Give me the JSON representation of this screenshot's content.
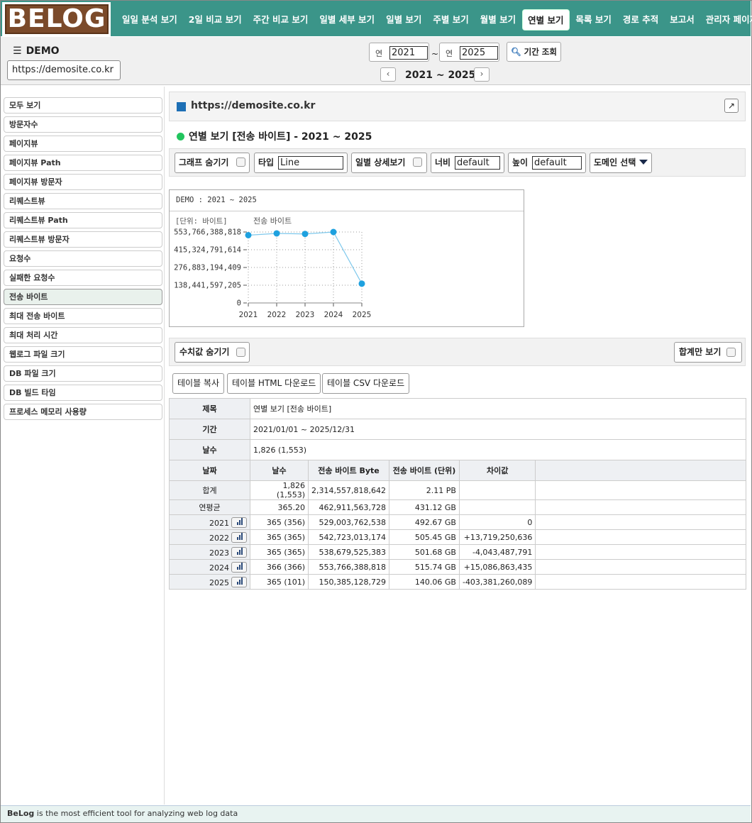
{
  "brand": {
    "logo_text": "BELOG"
  },
  "nav": [
    {
      "label": "일일 분석 보기"
    },
    {
      "label": "2일 비교 보기"
    },
    {
      "label": "주간 비교 보기"
    },
    {
      "label": "일별 세부 보기"
    },
    {
      "label": "일별 보기"
    },
    {
      "label": "주별 보기"
    },
    {
      "label": "월별 보기"
    },
    {
      "label": "연별 보기",
      "active": true
    },
    {
      "label": "목록 보기"
    },
    {
      "label": "경로 추적"
    },
    {
      "label": "보고서"
    },
    {
      "label": "관리자 페이지"
    }
  ],
  "site": {
    "name": "DEMO",
    "url": "https://demosite.co.kr"
  },
  "period": {
    "from_label": "연",
    "from_value": "2021",
    "to_label": "연",
    "to_value": "2025",
    "tilde": "~",
    "search_label": "기간 조회",
    "range_title": "2021 ~ 2025",
    "prev": "‹",
    "next": "›"
  },
  "sidebar": [
    {
      "label": "모두 보기"
    },
    {
      "label": "방문자수"
    },
    {
      "label": "페이지뷰"
    },
    {
      "label": "페이지뷰 Path"
    },
    {
      "label": "페이지뷰 방문자"
    },
    {
      "label": "리퀘스트뷰"
    },
    {
      "label": "리퀘스트뷰 Path"
    },
    {
      "label": "리퀘스트뷰 방문자"
    },
    {
      "label": "요청수"
    },
    {
      "label": "실패한 요청수"
    },
    {
      "label": "전송 바이트",
      "active": true
    },
    {
      "label": "최대 전송 바이트"
    },
    {
      "label": "최대 처리 시간"
    },
    {
      "label": "웹로그 파일 크기"
    },
    {
      "label": "DB 파일 크기"
    },
    {
      "label": "DB 빌드 타임"
    },
    {
      "label": "프로세스 메모리 사용량"
    }
  ],
  "card": {
    "url": "https://demosite.co.kr",
    "ext_icon": "↗"
  },
  "section_title": "연별 보기 [전송 바이트] - 2021 ~ 2025",
  "options": {
    "hide_graph": "그래프 숨기기",
    "type_label": "타입",
    "type_value": "Line",
    "daily_detail": "일별 상세보기",
    "width_label": "너비",
    "width_value": "default",
    "height_label": "높이",
    "height_value": "default",
    "domain_select": "도메인 선택"
  },
  "chart_data": {
    "type": "line",
    "title": "DEMO : 2021 ~ 2025",
    "unit_label": "[단위: 바이트]",
    "series": [
      {
        "name": "전송 바이트",
        "values": [
          529003762538,
          542723013174,
          538679525383,
          553766388818,
          150385128729
        ]
      }
    ],
    "categories": [
      "2021",
      "2022",
      "2023",
      "2024",
      "2025"
    ],
    "y_ticks": [
      {
        "value": 553766388818,
        "label": "553,766,388,818"
      },
      {
        "value": 415324791614,
        "label": "415,324,791,614"
      },
      {
        "value": 276883194409,
        "label": "276,883,194,409"
      },
      {
        "value": 138441597205,
        "label": "138,441,597,205"
      },
      {
        "value": 0,
        "label": "0"
      }
    ],
    "ylim": [
      0,
      553766388818
    ],
    "grid": true,
    "colors": {
      "line": "#7dc8ec",
      "point": "#1ea1df"
    }
  },
  "value_options": {
    "hide_values": "수치값 숨기기",
    "total_only": "합계만 보기"
  },
  "table_actions": {
    "copy": "테이블 복사",
    "html": "테이블 HTML 다운로드",
    "csv": "테이블 CSV 다운로드"
  },
  "table": {
    "meta": [
      {
        "key": "제목",
        "value": "연별 보기 [전송 바이트]"
      },
      {
        "key": "기간",
        "value": "2021/01/01 ~ 2025/12/31"
      },
      {
        "key": "날수",
        "value": "1,826 (1,553)"
      }
    ],
    "headers": [
      "날짜",
      "날수",
      "전송 바이트 Byte",
      "전송 바이트 (단위)",
      "차이값"
    ],
    "rows": [
      {
        "date": "합계",
        "days": "1,826 (1,553)",
        "bytes": "2,314,557,818,642",
        "unit": "2.11 PB",
        "diff": "",
        "chart": false
      },
      {
        "date": "연평균",
        "days": "365.20",
        "bytes": "462,911,563,728",
        "unit": "431.12 GB",
        "diff": "",
        "chart": false
      },
      {
        "date": "2021",
        "days": "365 (356)",
        "bytes": "529,003,762,538",
        "unit": "492.67 GB",
        "diff": "0",
        "chart": true
      },
      {
        "date": "2022",
        "days": "365 (365)",
        "bytes": "542,723,013,174",
        "unit": "505.45 GB",
        "diff": "+13,719,250,636",
        "chart": true
      },
      {
        "date": "2023",
        "days": "365 (365)",
        "bytes": "538,679,525,383",
        "unit": "501.68 GB",
        "diff": "-4,043,487,791",
        "chart": true
      },
      {
        "date": "2024",
        "days": "366 (366)",
        "bytes": "553,766,388,818",
        "unit": "515.74 GB",
        "diff": "+15,086,863,435",
        "chart": true
      },
      {
        "date": "2025",
        "days": "365 (101)",
        "bytes": "150,385,128,729",
        "unit": "140.06 GB",
        "diff": "-403,381,260,089",
        "chart": true
      }
    ]
  },
  "footer": {
    "brand": "BeLog",
    "text": " is the most efficient tool for analyzing web log data"
  }
}
